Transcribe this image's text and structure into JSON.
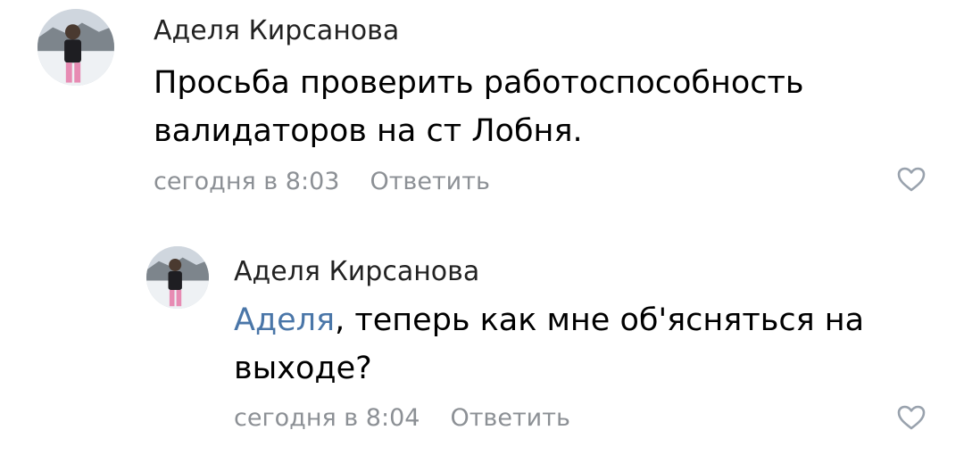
{
  "comments": [
    {
      "author": "Аделя Кирсанова",
      "text": "Просьба проверить работоспособность валидаторов на ст Лобня.",
      "time": "сегодня в 8:03",
      "reply_label": "Ответить",
      "avatar_icon": "user-avatar-photo",
      "like_icon": "heart-outline-icon"
    },
    {
      "author": "Аделя Кирсанова",
      "mention": "Аделя",
      "text": ", теперь как мне об'ясняться на выходе?",
      "time": "сегодня в 8:04",
      "reply_label": "Ответить",
      "avatar_icon": "user-avatar-photo",
      "like_icon": "heart-outline-icon"
    }
  ],
  "colors": {
    "mention": "#4a76a8",
    "meta": "#8c9095",
    "author": "#222222",
    "text": "#000000",
    "like_icon": "#99a2ad"
  }
}
